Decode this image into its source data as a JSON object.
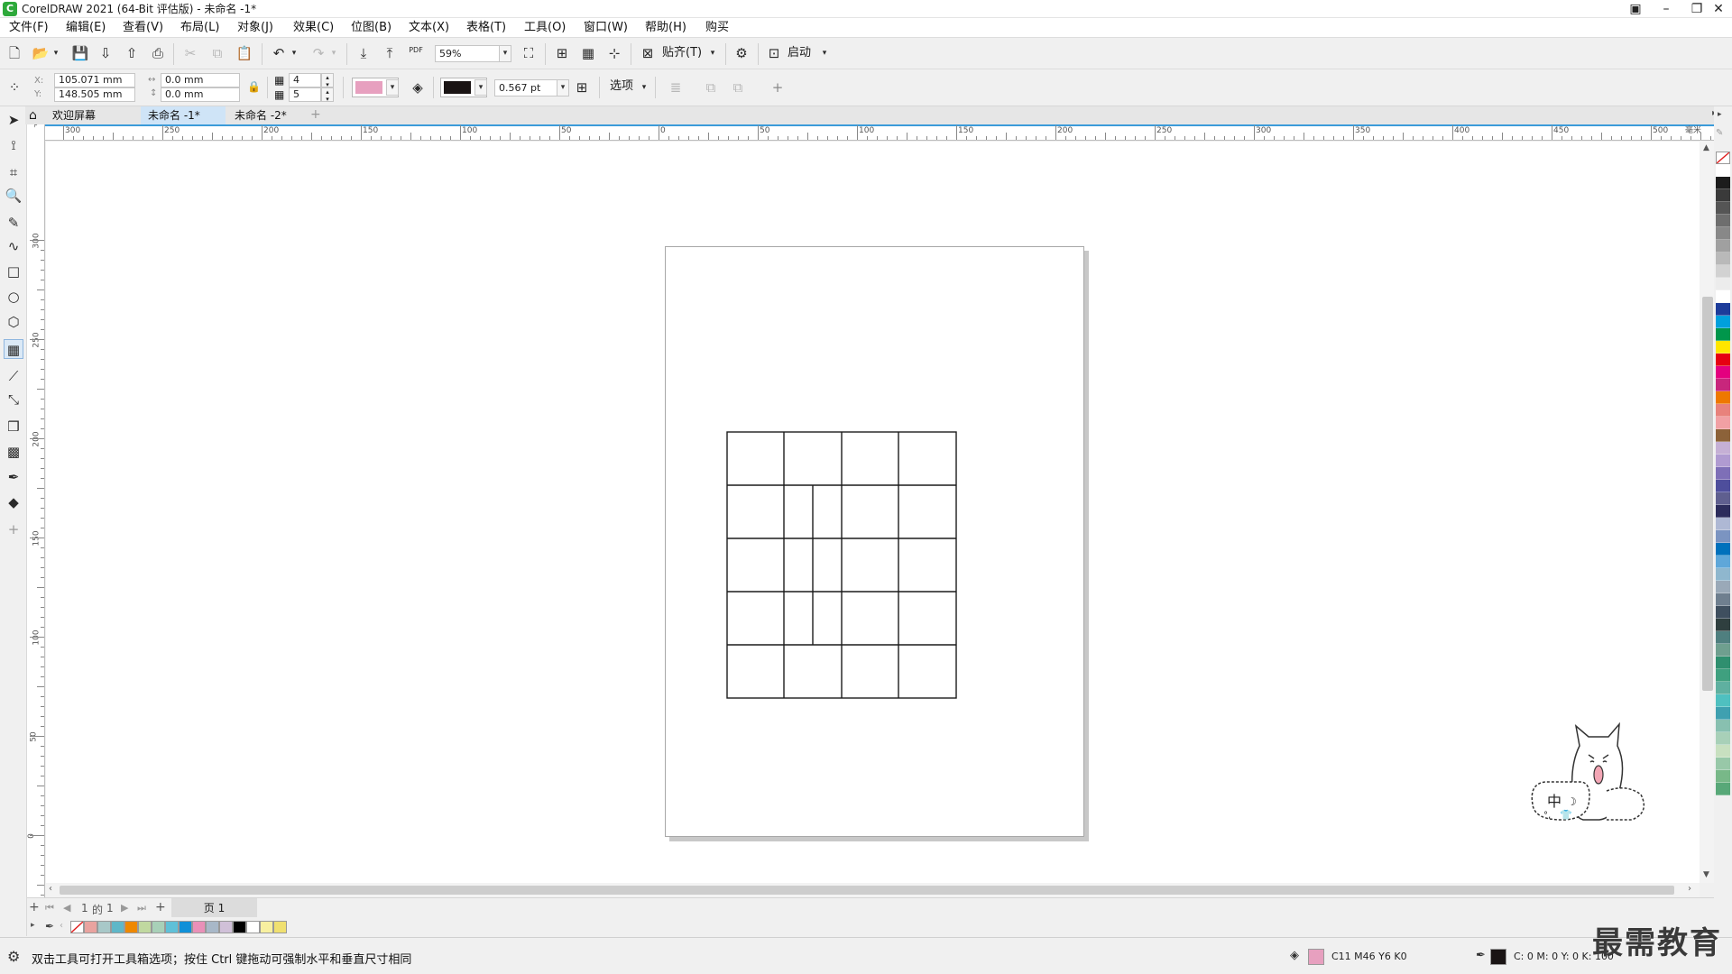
{
  "app": {
    "title": "CorelDRAW 2021 (64-Bit 评估版) - 未命名 -1*",
    "logo": "corel-balloon-icon"
  },
  "menu": [
    "文件(F)",
    "编辑(E)",
    "查看(V)",
    "布局(L)",
    "对象(J)",
    "效果(C)",
    "位图(B)",
    "文本(X)",
    "表格(T)",
    "工具(O)",
    "窗口(W)",
    "帮助(H)",
    "购买"
  ],
  "toolbar": {
    "zoom_value": "59%",
    "pdf_label": "PDF",
    "snap_label": "贴齐(T)",
    "launch_label": "启动"
  },
  "propbar": {
    "x_label": "X:",
    "x_value": "105.071 mm",
    "y_label": "Y:",
    "y_value": "148.505 mm",
    "w_value": "0.0 mm",
    "h_value": "0.0 mm",
    "rows_value": "4",
    "cols_value": "5",
    "fill_color": "#e7a0bf",
    "outline_color": "#1a1414",
    "outline_width": "0.567 pt",
    "options_label": "选项"
  },
  "tabs": [
    "欢迎屏幕",
    "未命名 -1*",
    "未命名 -2*"
  ],
  "active_tab": 1,
  "hruler": {
    "labels": [
      "300",
      "250",
      "200",
      "150",
      "100",
      "50",
      "0",
      "50",
      "100",
      "150",
      "200",
      "250",
      "300",
      "350",
      "400",
      "450",
      "500"
    ],
    "unit": "毫米"
  },
  "vruler": {
    "labels": [
      "300",
      "250",
      "200",
      "150",
      "100",
      "50",
      "0"
    ]
  },
  "pagenav": {
    "current": "1",
    "of_label": "的",
    "total": "1",
    "page_tab": "页 1"
  },
  "status": {
    "hint": "双击工具可打开工具箱选项；按住 Ctrl 键拖动可强制水平和垂直尺寸相同",
    "fill_text": "C11 M46 Y6 K0",
    "outline_text": "C: 0 M: 0 Y: 0 K: 100"
  },
  "watermark": "最需教育",
  "mascot_text": "中",
  "palette_colors": [
    "#ffffff",
    "#1c1c1c",
    "#3a3a3a",
    "#555555",
    "#6e6e6e",
    "#888888",
    "#a0a0a0",
    "#b9b9b9",
    "#d2d2d2",
    "#ececec",
    "#ffffff",
    "#1d3c9a",
    "#00a0dc",
    "#00964b",
    "#ffe600",
    "#e60012",
    "#e4007f",
    "#c8267c",
    "#ee7800",
    "#e8827c",
    "#f1a0a4",
    "#8c6239",
    "#c5b0d5",
    "#b09bd1",
    "#7e6fb7",
    "#4e4e9c",
    "#5f5f8f",
    "#2c2c5c",
    "#aeb8d4",
    "#7b94c1",
    "#0071bc",
    "#5fa7d9",
    "#8fb7ce",
    "#9aa9b8",
    "#6f7f8f",
    "#3f4f5f",
    "#2f3f3f",
    "#4f7f7f",
    "#6f9f8f",
    "#2f8f6f",
    "#3fa07f",
    "#5fb0a0",
    "#4fc0c0",
    "#3fa0b0",
    "#88c0b0",
    "#a8d0b8",
    "#c8e0c0",
    "#98c8a8",
    "#78b888",
    "#58a878"
  ],
  "doc_palette": [
    "#e9a39f",
    "#a8c8c8",
    "#5fb7c8",
    "#ee8800",
    "#c0d8a0",
    "#a8d0b8",
    "#5fc0d8",
    "#1090d8",
    "#e990b8",
    "#a8b8c8",
    "#d0c0d8",
    "#000000",
    "#ffffff",
    "#f8f0a0",
    "#f0e070"
  ]
}
